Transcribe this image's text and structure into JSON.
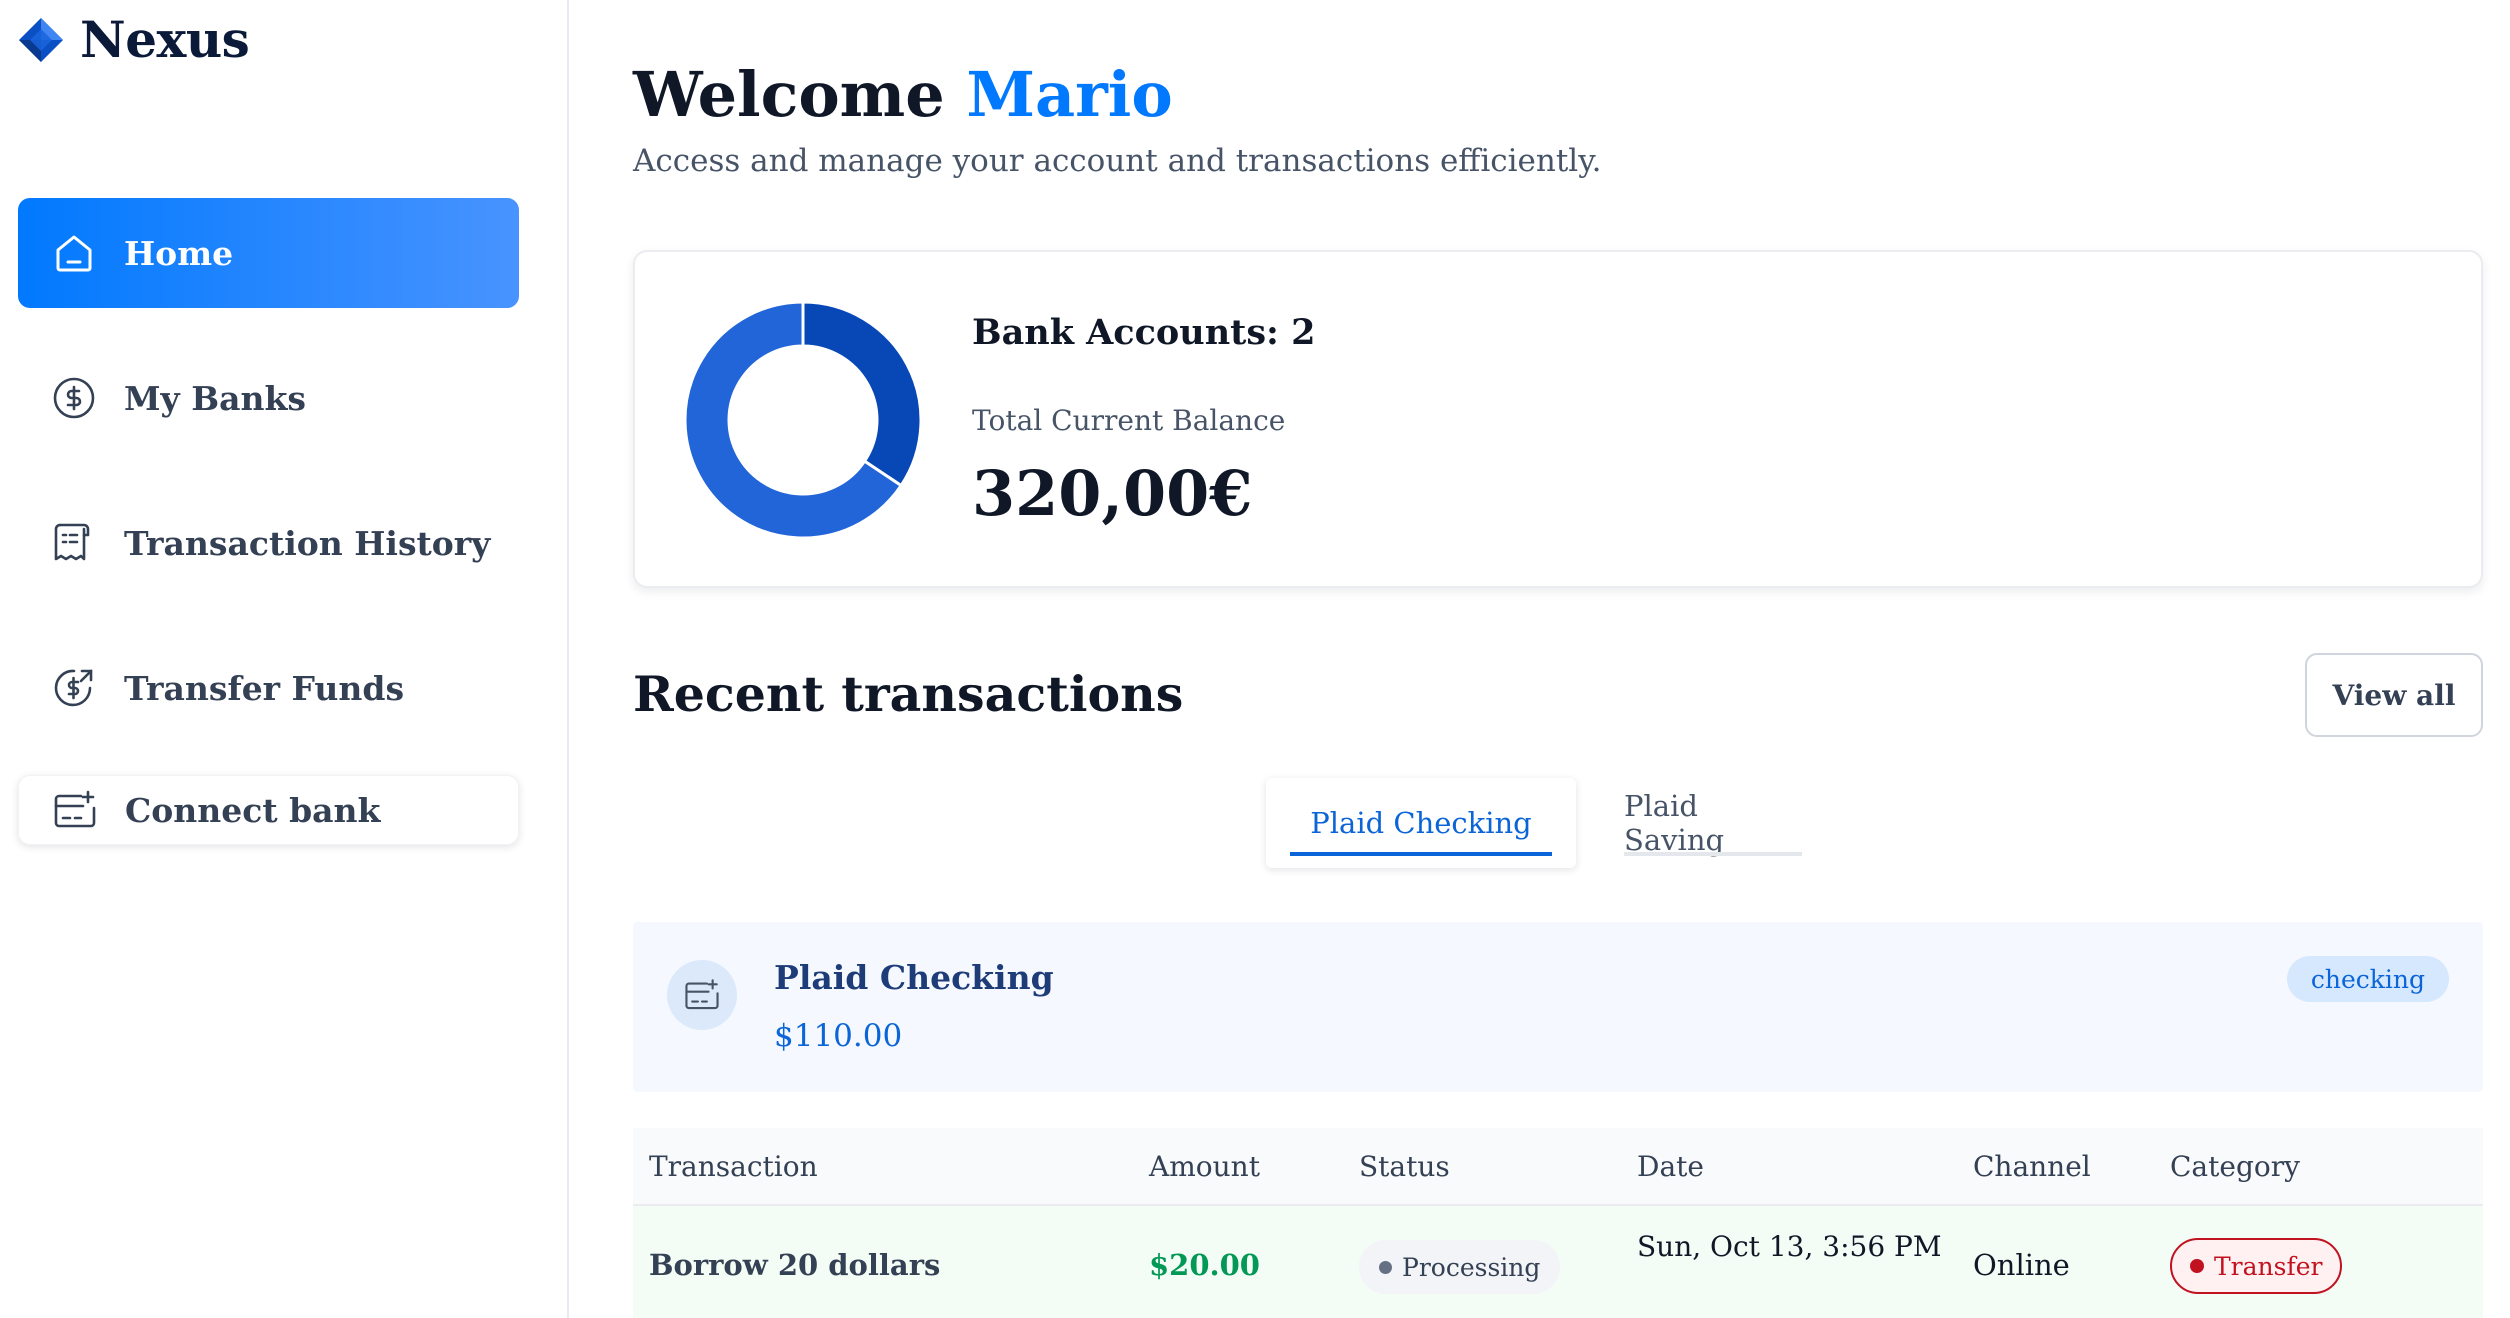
{
  "app": {
    "name": "Nexus"
  },
  "sidebar": {
    "items": [
      {
        "label": "Home",
        "icon": "home-icon",
        "active": true
      },
      {
        "label": "My Banks",
        "icon": "dollar-circle-icon",
        "active": false
      },
      {
        "label": "Transaction History",
        "icon": "receipt-icon",
        "active": false
      },
      {
        "label": "Transfer Funds",
        "icon": "money-send-icon",
        "active": false
      }
    ],
    "connect_bank": {
      "label": "Connect bank",
      "icon": "card-add-icon"
    }
  },
  "header": {
    "welcome": "Welcome",
    "user_name": "Mario",
    "subtitle": "Access and manage your account and transactions efficiently."
  },
  "balance": {
    "bank_accounts_label": "Bank Accounts: 2",
    "total_label": "Total Current Balance",
    "total_value": "320,00€",
    "donut": {
      "type": "pie",
      "slices": [
        {
          "value": 110,
          "color": "#0747b6"
        },
        {
          "value": 210,
          "color": "#2265d8"
        }
      ]
    }
  },
  "recent": {
    "title": "Recent transactions",
    "view_all": "View all",
    "tabs": [
      {
        "label": "Plaid Checking",
        "active": true
      },
      {
        "label": "Plaid Saving",
        "active": false
      }
    ],
    "account": {
      "name": "Plaid Checking",
      "balance": "$110.00",
      "badge": "checking"
    },
    "columns": [
      "Transaction",
      "Amount",
      "Status",
      "Date",
      "Channel",
      "Category"
    ],
    "rows": [
      {
        "name": "Borrow 20 dollars",
        "amount": "$20.00",
        "status": "Processing",
        "date": "Sun, Oct 13, 3:56 PM",
        "channel": "Online",
        "category": "Transfer"
      }
    ]
  },
  "colors": {
    "accent": "#0179fe",
    "success": "#039855",
    "danger": "#c1121f"
  }
}
